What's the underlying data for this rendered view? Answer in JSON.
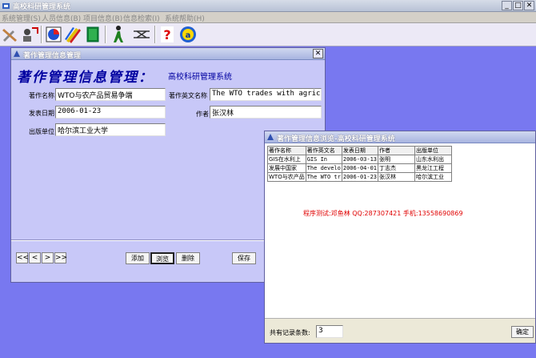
{
  "app": {
    "title": "高校科研管理系统"
  },
  "menu": [
    "系统管理(S)",
    "人员信息(B)",
    "项目信息(B)",
    "信息检索(I)",
    "系统帮助(H)"
  ],
  "toolbar": {
    "icons": [
      "tools-icon",
      "user-settings-icon",
      "chart-icon",
      "pencils-icon",
      "book-icon",
      "person-walk-icon",
      "network-icon",
      "help-icon",
      "about-icon"
    ]
  },
  "form": {
    "window_title": "著作管理信息管理",
    "heading": "著作管理信息管理：",
    "subheading": "高校科研管理系统",
    "name_label": "著作名称",
    "name_value": "WTO与农产品贸易争端",
    "en_name_label": "著作英文名称",
    "en_name_value": "The WTO trades with agricu",
    "date_label": "发表日期",
    "date_value": "2006-01-23",
    "author_label": "作者",
    "author_value": "张汉林",
    "publisher_label": "出版单位",
    "publisher_value": "哈尔滨工业大学",
    "nav": [
      "<<",
      "<",
      ">",
      ">>"
    ],
    "add_label": "添加",
    "browse_label": "浏览",
    "delete_label": "删除",
    "save_label": "保存"
  },
  "browse": {
    "window_title": "著作管理信息浏览-高校科研管理系统",
    "columns": [
      "著作名称",
      "著作英文名",
      "发表日期",
      "作者",
      "出版单位"
    ],
    "rows": [
      [
        "GIS在水利上",
        "GIS In",
        "2006-03-13",
        "张明",
        "山东水利出"
      ],
      [
        "发展中国家",
        "The develo",
        "2006-04-01",
        "丁志杰",
        "黑龙江工程"
      ],
      [
        "WTO与农产品",
        "The WTO tr",
        "2006-01-23",
        "张汉林",
        "哈尔滨工业"
      ]
    ],
    "credit": "程序测试:邓鱼林 QQ:287307421 手机:13558690869",
    "count_label": "共有记录条数:",
    "count_value": "3",
    "ok_label": "确定"
  }
}
